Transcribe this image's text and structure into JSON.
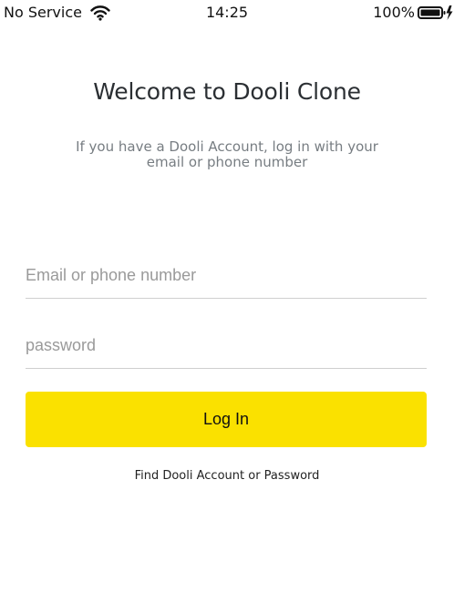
{
  "status_bar": {
    "carrier": "No Service",
    "time": "14:25",
    "battery_percent": "100%",
    "wifi_icon": "wifi-icon",
    "battery_icon": "battery-charging-icon"
  },
  "login": {
    "title": "Welcome to Dooli Clone",
    "subtitle": "If you have a Dooli Account, log in with your email or phone number",
    "email_placeholder": "Email or phone number",
    "email_value": "",
    "password_placeholder": "password",
    "password_value": "",
    "login_button_label": "Log In",
    "find_account_link": "Find Dooli Account or Password"
  },
  "colors": {
    "accent": "#fae100",
    "title": "#2b2f33",
    "subtitle": "#777d82"
  }
}
